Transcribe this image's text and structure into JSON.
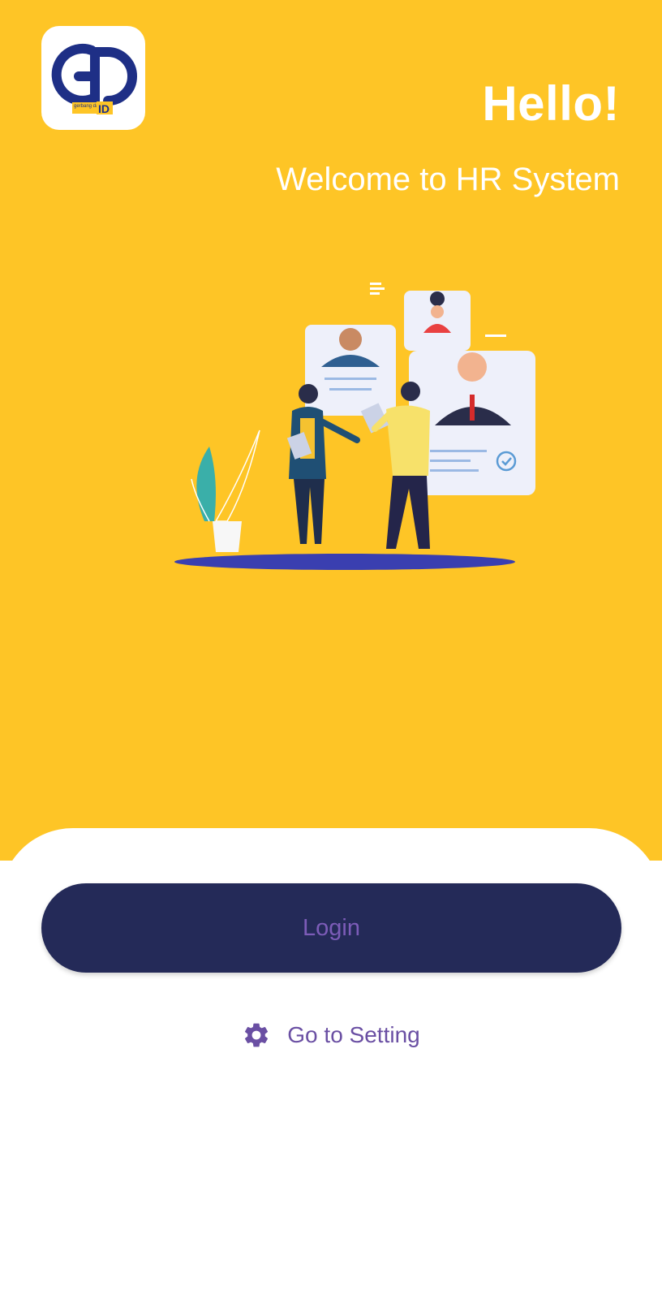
{
  "header": {
    "logo_text": "GD",
    "logo_subtext": "gerbang data",
    "logo_badge": "ID",
    "greeting": "Hello!",
    "subtitle": "Welcome to HR System"
  },
  "illustration": {
    "icon": "hr-recruitment-illustration"
  },
  "actions": {
    "login_label": "Login",
    "setting_label": "Go to Setting",
    "setting_icon": "gear-icon"
  },
  "colors": {
    "hero_background": "#FEC526",
    "button_background": "#242A58",
    "accent": "#6A4FA3"
  }
}
